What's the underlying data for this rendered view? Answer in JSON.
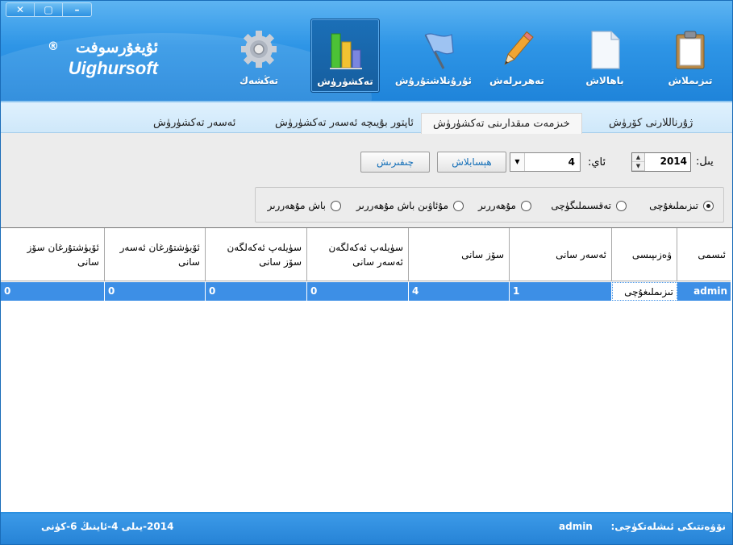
{
  "window": {
    "close_glyph": "✕",
    "restore_glyph": "▢",
    "minimize_glyph": "–"
  },
  "brand": {
    "logo_ug": "ئۇيغۇرسوفت",
    "logo_reg": "®",
    "logo_en": "Uighursoft"
  },
  "nav": {
    "items": [
      {
        "label": "تىزىملاش",
        "icon": "clipboard-icon"
      },
      {
        "label": "باھالاش",
        "icon": "document-icon"
      },
      {
        "label": "تەھرىرلەش",
        "icon": "pencil-icon"
      },
      {
        "label": "ئۇرۇنلاشتۇرۇش",
        "icon": "flag-icon"
      },
      {
        "label": "تەكشۈرۈش",
        "icon": "bar-chart-icon"
      },
      {
        "label": "تەڭشەك",
        "icon": "gear-icon"
      }
    ],
    "active_index": 4
  },
  "tabs": [
    {
      "label": "ژۇرناللارنى كۆرۈش"
    },
    {
      "label": "خىزمەت مىقدارىنى تەكشۈرۈش"
    },
    {
      "label": "ئاپتور بۇيىچە ئەسەر تەكشۈرۈش"
    },
    {
      "label": "ئەسەر تەكشۈرۈش"
    }
  ],
  "filters": {
    "year_label": "يىل:",
    "year_value": "2014",
    "month_label": "ئاي:",
    "month_value": "4",
    "calculate_button": "ھېسابلاش",
    "print_button": "چىقىرىش",
    "roles": [
      {
        "label": "تىزىملىغۇچى",
        "selected": true
      },
      {
        "label": "تەقسىملىگۈچى",
        "selected": false
      },
      {
        "label": "مۇھەررىر",
        "selected": false
      },
      {
        "label": "مۇئاۋىن باش مۇھەررىر",
        "selected": false
      },
      {
        "label": "باش مۇھەررىر",
        "selected": false
      }
    ]
  },
  "table": {
    "columns": [
      "ئىسمى",
      "ۋەزىپىسى",
      "ئەسەر سانى",
      "سۆز سانى",
      "سۈيلەپ ئەكەلگەن ئەسەر سانى",
      "سۈيلەپ ئەكەلگەن سۆز سانى",
      "ئۆيۈشتۇرغان ئەسەر سانى",
      "ئۆيۈشتۇرغان سۆز سانى"
    ],
    "rows": [
      [
        "admin",
        "تىزىملىغۇچى",
        "1",
        "4",
        "0",
        "0",
        "0",
        "0"
      ]
    ]
  },
  "status": {
    "operator_label": "نۆۋەتتىكى ئىشلەتكۈچى:",
    "operator_value": "admin",
    "date_text": "2014-يىلى 4-ئاينىڭ 6-كۈنى"
  },
  "colors": {
    "header_blue": "#2e95e6",
    "selection_blue": "#3d8fe6",
    "accent_text": "#1670b8"
  }
}
